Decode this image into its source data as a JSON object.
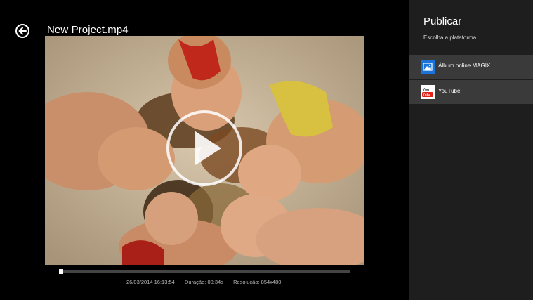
{
  "app": {
    "title": "New Project.mp4"
  },
  "player": {
    "progress_fraction": 0.0,
    "date": "26/03/2014 16:13:54",
    "duration": "Duração: 00:34s",
    "resolution": "Resolução: 854x480"
  },
  "flyout": {
    "title": "Publicar",
    "subtitle": "Escolha a plataforma",
    "platforms": [
      {
        "label": "Álbum online MAGIX",
        "icon": "photo-album-icon",
        "color": "#1a73d9"
      },
      {
        "label": "YouTube",
        "icon": "youtube-icon",
        "color": "#e62117"
      }
    ]
  },
  "colors": {
    "background": "#000000",
    "flyout_bg": "#1e1e1e",
    "item_bg": "#3a3a3a"
  }
}
